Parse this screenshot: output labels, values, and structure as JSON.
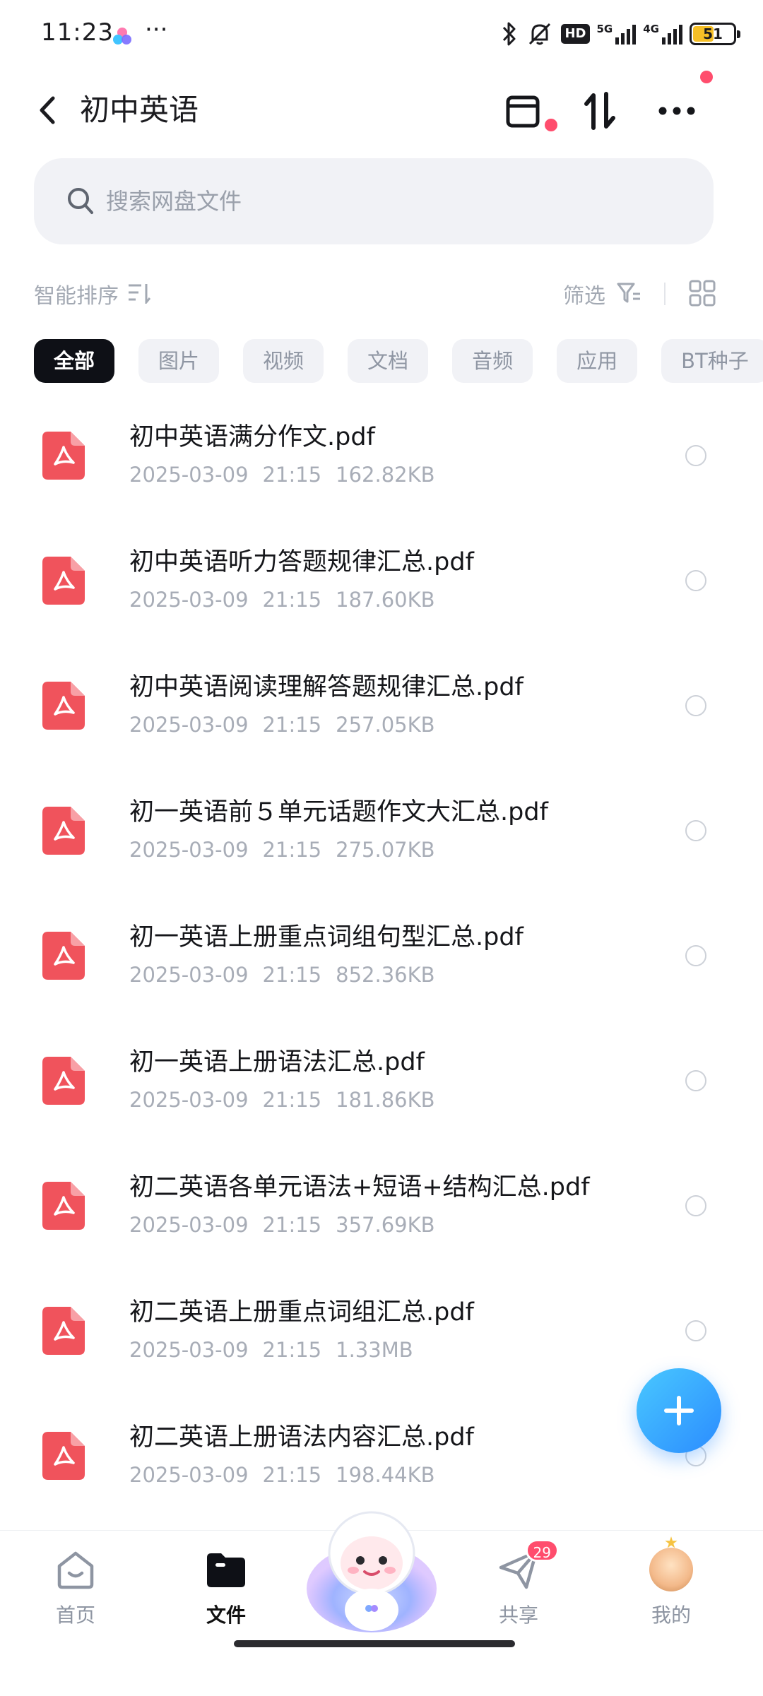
{
  "status_bar": {
    "time": "11:23",
    "dots": "···",
    "hd_label": "HD",
    "net1": "5G",
    "net2": "4G",
    "battery": "51",
    "battery_level": 0.51
  },
  "header": {
    "title": "初中英语"
  },
  "search": {
    "placeholder": "搜索网盘文件"
  },
  "toolbar": {
    "sort_label": "智能排序",
    "filter_label": "筛选"
  },
  "categories": [
    "全部",
    "图片",
    "视频",
    "文档",
    "音频",
    "应用",
    "BT种子"
  ],
  "files": [
    {
      "name": "初中英语满分作文.pdf",
      "date": "2025-03-09",
      "time": "21:15",
      "size": "162.82KB"
    },
    {
      "name": "初中英语听力答题规律汇总.pdf",
      "date": "2025-03-09",
      "time": "21:15",
      "size": "187.60KB"
    },
    {
      "name": "初中英语阅读理解答题规律汇总.pdf",
      "date": "2025-03-09",
      "time": "21:15",
      "size": "257.05KB"
    },
    {
      "name": "初一英语前５单元话题作文大汇总.pdf",
      "date": "2025-03-09",
      "time": "21:15",
      "size": "275.07KB"
    },
    {
      "name": "初一英语上册重点词组句型汇总.pdf",
      "date": "2025-03-09",
      "time": "21:15",
      "size": "852.36KB"
    },
    {
      "name": "初一英语上册语法汇总.pdf",
      "date": "2025-03-09",
      "time": "21:15",
      "size": "181.86KB"
    },
    {
      "name": "初二英语各单元语法+短语+结构汇总.pdf",
      "date": "2025-03-09",
      "time": "21:15",
      "size": "357.69KB"
    },
    {
      "name": "初二英语上册重点词组汇总.pdf",
      "date": "2025-03-09",
      "time": "21:15",
      "size": "1.33MB"
    },
    {
      "name": "初二英语上册语法内容汇总.pdf",
      "date": "2025-03-09",
      "time": "21:15",
      "size": "198.44KB"
    }
  ],
  "bottom_nav": {
    "items": [
      {
        "label": "首页",
        "icon": "home-icon"
      },
      {
        "label": "文件",
        "icon": "folder-icon"
      },
      {
        "label": "",
        "icon": "mascot-icon"
      },
      {
        "label": "共享",
        "icon": "share-plane-icon",
        "badge": "29"
      },
      {
        "label": "我的",
        "icon": "avatar"
      }
    ]
  },
  "colors": {
    "accent": "#2b8cff",
    "badge": "#ff4d6d",
    "pdf": "#f0535c",
    "active_chip": "#0e1016"
  }
}
